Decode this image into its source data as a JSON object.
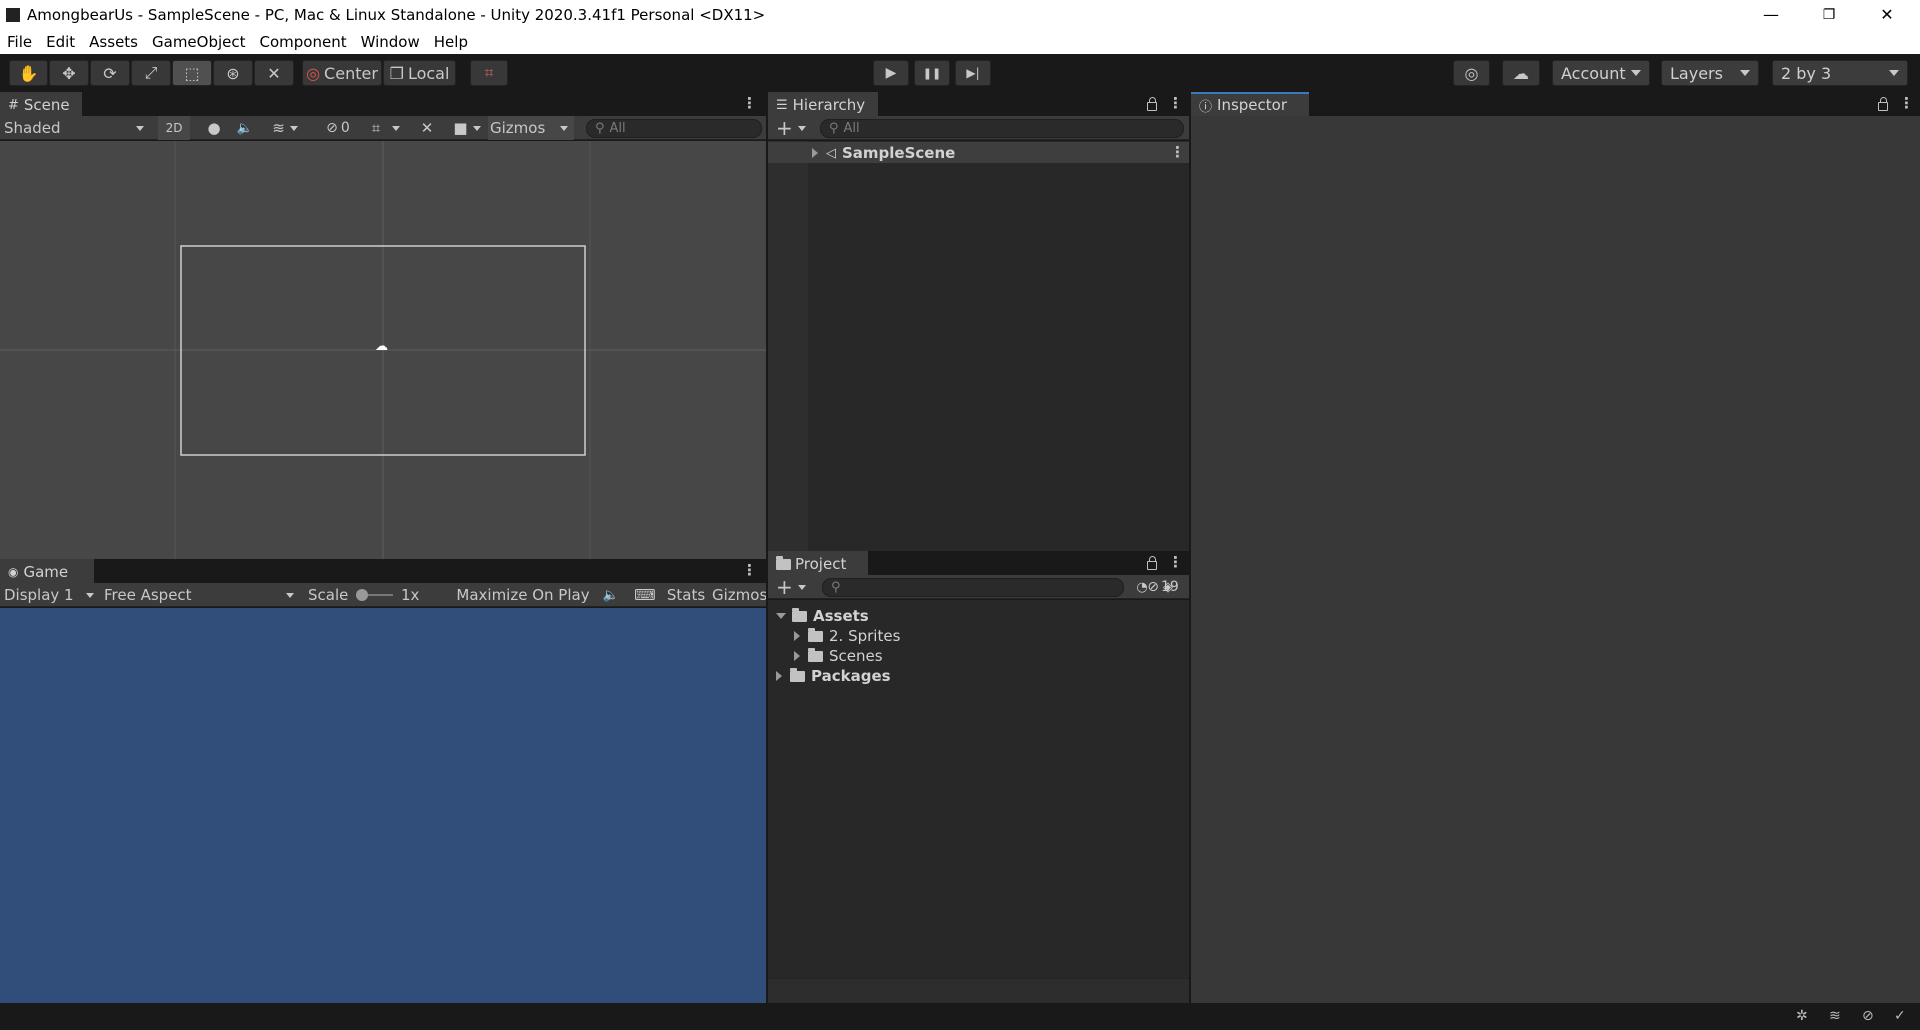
{
  "window": {
    "title": "AmongbearUs - SampleScene - PC, Mac & Linux Standalone - Unity 2020.3.41f1 Personal <DX11>",
    "minimize": "—",
    "restore": "❐",
    "close": "✕"
  },
  "menu": [
    "File",
    "Edit",
    "Assets",
    "GameObject",
    "Component",
    "Window",
    "Help"
  ],
  "toolbar": {
    "tools": [
      "hand-icon",
      "move-icon",
      "rotate-icon",
      "scale-icon",
      "rect-icon",
      "transform-icon",
      "custom-tool-icon"
    ],
    "pivot_label": "Center",
    "space_label": "Local",
    "play": "▶",
    "pause": "❚❚",
    "step": "▶|",
    "account_label": "Account",
    "layers_label": "Layers",
    "layout_label": "2 by 3"
  },
  "scene": {
    "tab_label": "Scene",
    "shading_mode": "Shaded",
    "mode_2d": "2D",
    "hidden_count": "0",
    "gizmos_label": "Gizmos",
    "search_placeholder": "All",
    "colors": {
      "background": "#474747",
      "grid": "#585858"
    }
  },
  "game": {
    "tab_label": "Game",
    "display": "Display 1",
    "aspect": "Free Aspect",
    "scale_label": "Scale",
    "scale_value": "1x",
    "maximize_label": "Maximize On Play",
    "stats_label": "Stats",
    "gizmos_label": "Gizmos",
    "colors": {
      "background": "#314d79"
    }
  },
  "hierarchy": {
    "tab_label": "Hierarchy",
    "search_placeholder": "All",
    "scene_item": "SampleScene"
  },
  "project": {
    "tab_label": "Project",
    "hidden_count": "19",
    "tree": {
      "assets": "Assets",
      "sprites": "2. Sprites",
      "scenes": "Scenes",
      "packages": "Packages"
    }
  },
  "inspector": {
    "tab_label": "Inspector"
  },
  "accent_color": "#3a79bb"
}
